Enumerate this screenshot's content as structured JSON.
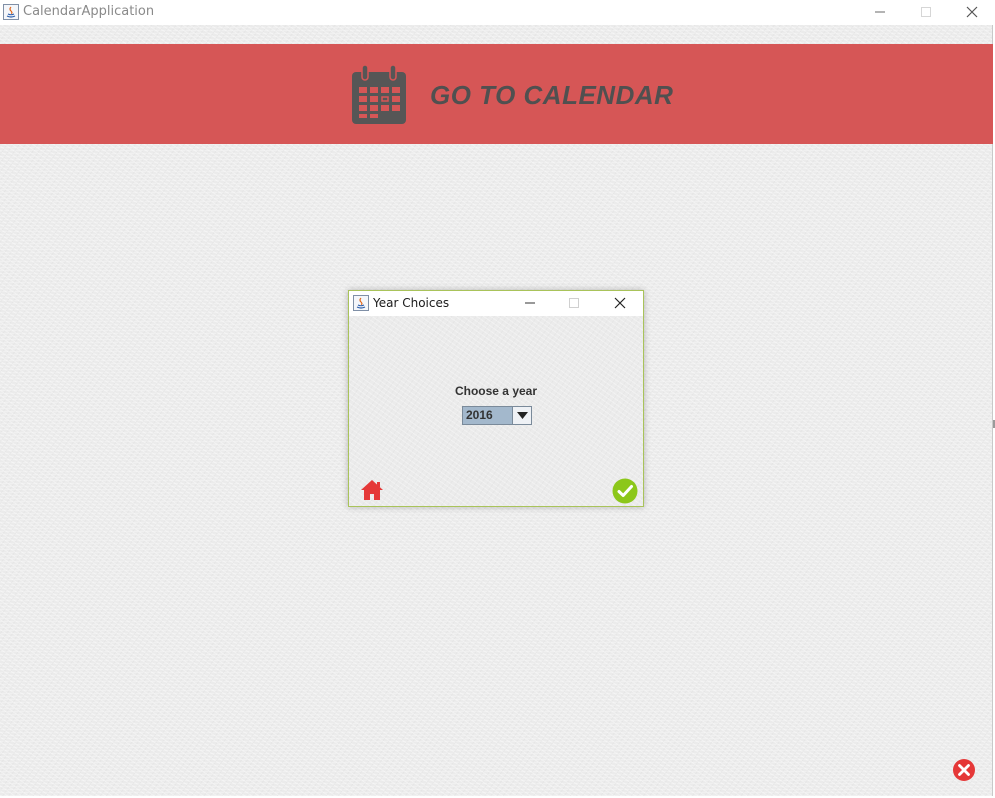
{
  "window": {
    "title": "CalendarApplication",
    "icons": {
      "app": "java-app-icon",
      "minimize": "minimize-icon",
      "maximize": "maximize-icon",
      "close": "close-icon"
    }
  },
  "banner": {
    "title": "GO TO CALENDAR",
    "icon": "calendar-icon",
    "background_color": "#d65656",
    "text_color": "#505050"
  },
  "dialog": {
    "title": "Year Choices",
    "label": "Choose a year",
    "year_select": {
      "selected": "2016"
    },
    "buttons": {
      "home": "home-icon",
      "confirm": "check-circle-icon"
    },
    "border_color": "#a9c35a"
  },
  "exit_button": {
    "icon": "close-circle-icon",
    "color": "#e53838"
  },
  "colors": {
    "background": "#ebebeb",
    "home": "#e53838",
    "confirm": "#8cc71a",
    "select_highlight": "#a3b8cc"
  }
}
